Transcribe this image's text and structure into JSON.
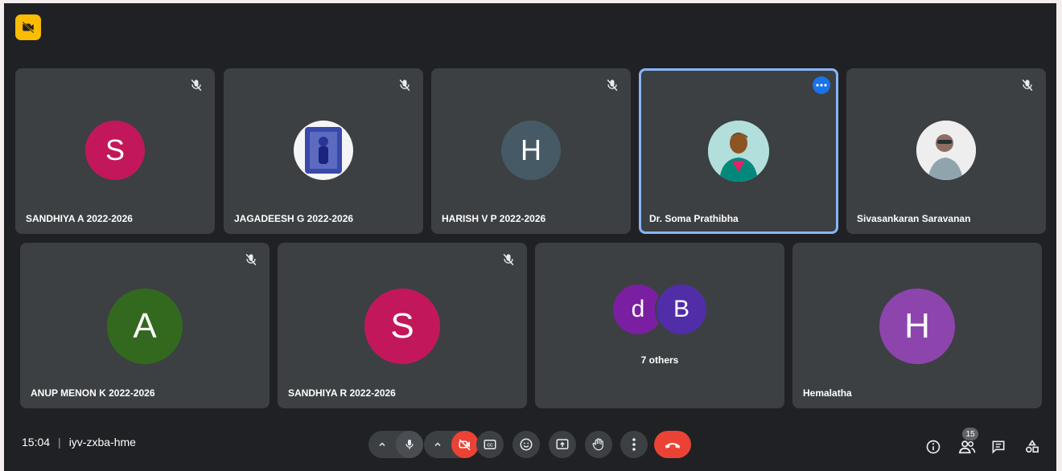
{
  "top_badge": {
    "icon": "video-off-badge-icon",
    "color": "#fbbc04"
  },
  "row1": [
    {
      "name": "SANDHIYA A 2022-2026",
      "initial": "S",
      "avatar_color": "#c2185b",
      "muted": true
    },
    {
      "name": "JAGADEESH G 2022-2026",
      "initial": "",
      "avatar_color": "#e8eaf6",
      "photo": true,
      "muted": true
    },
    {
      "name": "HARISH V P 2022-2026",
      "initial": "H",
      "avatar_color": "#455a64",
      "muted": true
    },
    {
      "name": "Dr. Soma Prathibha",
      "initial": "",
      "avatar_color": "#26a69a",
      "photo": true,
      "muted": false,
      "active": true
    },
    {
      "name": "Sivasankaran Saravanan",
      "initial": "",
      "avatar_color": "#f5f5f5",
      "photo": true,
      "muted": true
    }
  ],
  "row2": [
    {
      "name": "ANUP MENON K 2022-2026",
      "initial": "A",
      "avatar_color": "#33691e",
      "muted": true
    },
    {
      "name": "SANDHIYA R 2022-2026",
      "initial": "S",
      "avatar_color": "#c2185b",
      "muted": true
    },
    {
      "name": "",
      "others_label": "7 others",
      "avatars": [
        {
          "initial": "d",
          "color": "#7b1fa2"
        },
        {
          "initial": "B",
          "color": "#512da8"
        }
      ]
    },
    {
      "name": "Hemalatha",
      "initial": "H",
      "avatar_color": "#8e44ad",
      "muted": false
    }
  ],
  "bottom_bar": {
    "time": "15:04",
    "separator": "|",
    "meeting_code": "iyv-zxba-hme",
    "participant_count": "15",
    "accent_end_call": "#ea4335"
  }
}
